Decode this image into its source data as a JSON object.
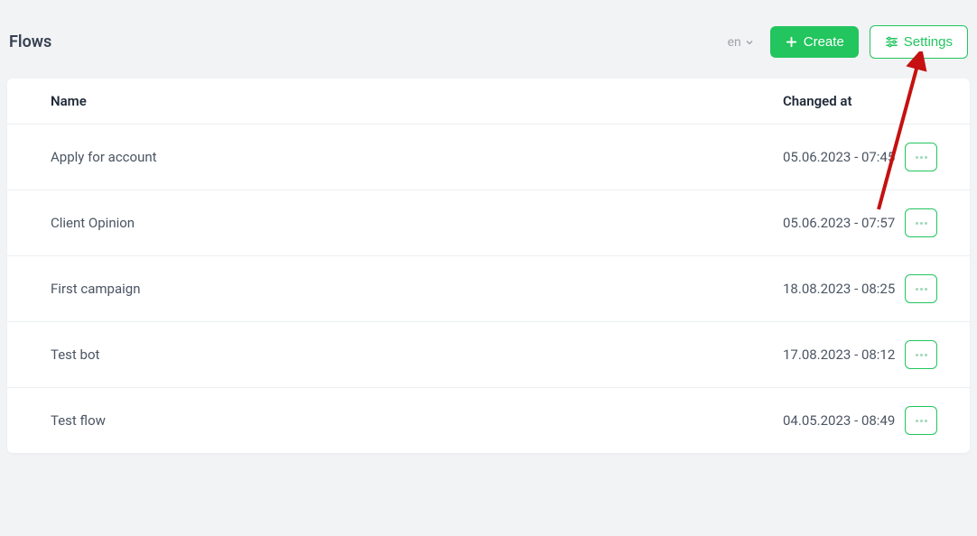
{
  "header": {
    "title": "Flows",
    "language": "en",
    "create_label": "Create",
    "settings_label": "Settings"
  },
  "table": {
    "columns": {
      "name": "Name",
      "changed_at": "Changed at"
    },
    "rows": [
      {
        "name": "Apply for account",
        "changed_at": "05.06.2023 - 07:45"
      },
      {
        "name": "Client Opinion",
        "changed_at": "05.06.2023 - 07:57"
      },
      {
        "name": "First campaign",
        "changed_at": "18.08.2023 - 08:25"
      },
      {
        "name": "Test bot",
        "changed_at": "17.08.2023 - 08:12"
      },
      {
        "name": "Test flow",
        "changed_at": "04.05.2023 - 08:49"
      }
    ]
  }
}
